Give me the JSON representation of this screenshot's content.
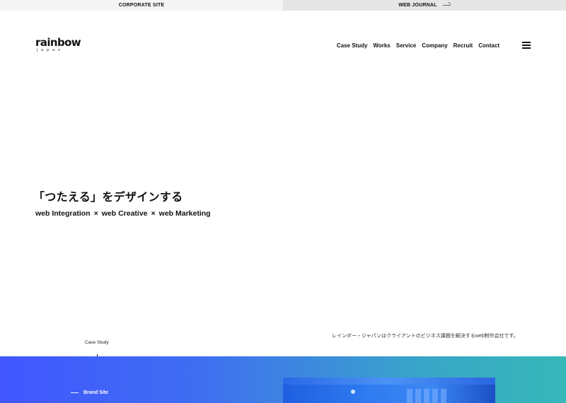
{
  "topbar": {
    "corporate_label": "CORPORATE SITE",
    "journal_label": "WEB JOURNAL",
    "journal_icon": "arrow-right-icon"
  },
  "header": {
    "logo_text": "rainbow",
    "logo_sub": "japan",
    "nav": [
      {
        "label": "Case Study"
      },
      {
        "label": "Works"
      },
      {
        "label": "Service"
      },
      {
        "label": "Company"
      },
      {
        "label": "Recruit"
      },
      {
        "label": "Contact"
      }
    ],
    "menu_icon": "hamburger-menu-icon"
  },
  "hero": {
    "title": "「つたえる」をデザインする",
    "sub": [
      "web Integration",
      "web Creative",
      "web Marketing"
    ],
    "separator": "×",
    "description": "レインボー・ジャパンはクライアントのビジネス課題を解決するweb制作会社です。"
  },
  "scroll": {
    "label": "Case Study"
  },
  "band": {
    "brand_site_label": "Brand Site",
    "gradient_start": "#4156ff",
    "gradient_end": "#36b8b8"
  }
}
